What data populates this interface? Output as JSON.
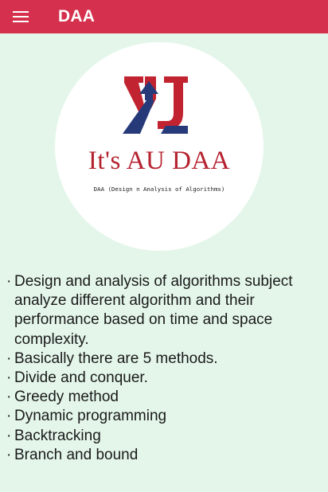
{
  "appbar": {
    "title": "DAA",
    "menu_icon": "hamburger-menu-icon",
    "background": "#d5304d"
  },
  "logo": {
    "mark_letters": "AU",
    "name": "It's AU DAA",
    "subtitle": "DAA (Design n Analysis of Algorithms)",
    "colors": {
      "red": "#c22331",
      "navy": "#263a7a"
    }
  },
  "content": {
    "bullet_char": "·",
    "items": [
      "Design and analysis of algorithms subject analyze different algorithm and their performance based on time and space complexity.",
      "Basically there are 5 methods.",
      "Divide and conquer.",
      "Greedy method",
      "Dynamic programming",
      "Backtracking",
      "Branch and bound"
    ]
  },
  "page": {
    "background": "#e4f6ea"
  }
}
